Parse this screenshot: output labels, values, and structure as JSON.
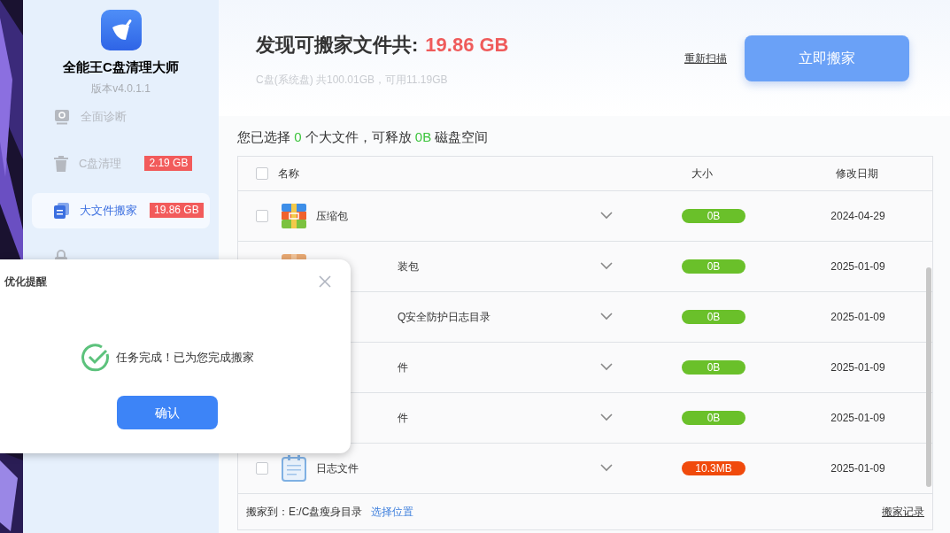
{
  "sidebar": {
    "app_name": "全能王C盘清理大师",
    "version": "版本v4.0.1.1",
    "items": [
      {
        "label": "全面诊断",
        "kind": "search",
        "selected": false
      },
      {
        "label": "C盘清理",
        "kind": "trash",
        "badge": "2.19 GB",
        "selected": false
      },
      {
        "label": "大文件搬家",
        "kind": "files",
        "badge": "19.86 GB",
        "selected": true
      },
      {
        "kind": "lock",
        "selected": false
      }
    ]
  },
  "header": {
    "title": "发现可搬家文件共:",
    "total": "19.86 GB",
    "disk_info": "C盘(系统盘) 共100.01GB，可用11.19GB",
    "rescan_link": "重新扫描",
    "move_button": "立即搬家"
  },
  "summary": {
    "prefix": "您已选择",
    "count": "0",
    "middle": "个大文件，可释放",
    "size": "0B",
    "suffix": "磁盘空间"
  },
  "table": {
    "columns": [
      "名称",
      "大小",
      "修改日期"
    ],
    "all_checked": false,
    "rows": [
      {
        "name": "压缩包",
        "kind": "archive",
        "size": "0B",
        "color": "#6ac02a",
        "date": "2024-04-29",
        "checked": false
      },
      {
        "name": "装包",
        "kind": "package",
        "size": "0B",
        "color": "#6ac02a",
        "date": "2025-01-09"
      },
      {
        "name": "Q安全防护日志目录",
        "size": "0B",
        "color": "#6ac02a",
        "date": "2025-01-09"
      },
      {
        "name": "件",
        "size": "0B",
        "color": "#6ac02a",
        "date": "2025-01-09"
      },
      {
        "name": "件",
        "size": "0B",
        "color": "#6ac02a",
        "date": "2025-01-09"
      },
      {
        "name": "日志文件",
        "kind": "log",
        "size": "10.3MB",
        "color": "#f04a0c",
        "date": "2025-01-09",
        "checked": false
      }
    ],
    "footer": {
      "target_label": "搬家到：E:/C盘瘦身目录",
      "choose_link": "选择位置",
      "history_link": "搬家记录"
    }
  },
  "dialog": {
    "title": "优化提醒",
    "message": "任务完成！已为您完成搬家",
    "confirm_button": "确认"
  }
}
